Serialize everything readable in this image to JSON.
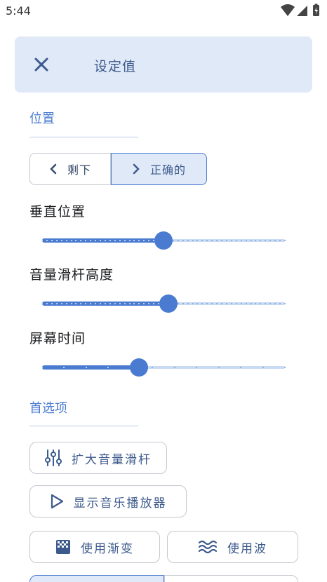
{
  "status": {
    "time": "5:44"
  },
  "header": {
    "title": "设定值"
  },
  "position": {
    "section_label": "位置",
    "left_label": "剩下",
    "right_label": "正确的",
    "selected": "right"
  },
  "sliders": [
    {
      "label": "垂直位置",
      "value": 0.5,
      "ticks": 50
    },
    {
      "label": "音量滑杆高度",
      "value": 0.52,
      "ticks": 50
    },
    {
      "label": "屏幕时间",
      "value": 0.4,
      "ticks": 11
    }
  ],
  "preferences": {
    "section_label": "首选项",
    "expand_volume_slider": "扩大音量滑杆",
    "show_music_player": "显示音乐播放器",
    "use_gradient": "使用渐变",
    "use_wave": "使用波"
  },
  "colors": {
    "accent": "#4a7bd0",
    "header_bg": "#e0e9f8",
    "track_inactive": "#c9daf3"
  }
}
